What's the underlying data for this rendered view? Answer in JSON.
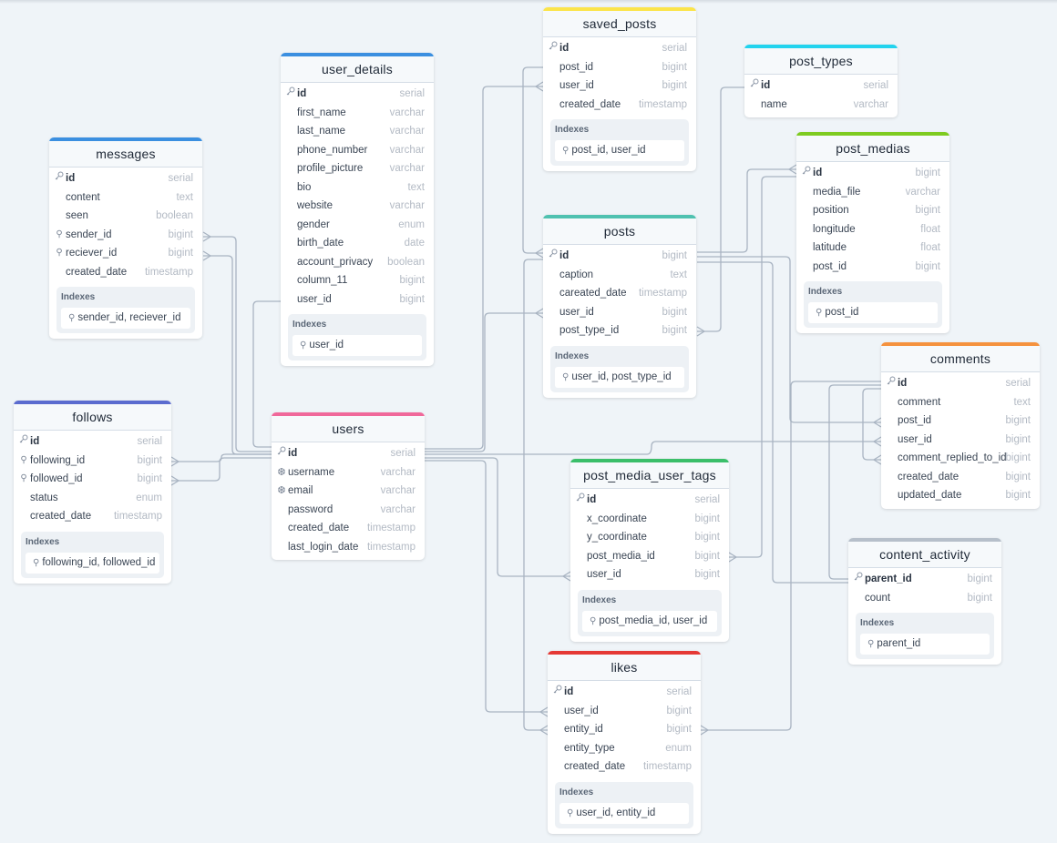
{
  "tables": [
    {
      "key": "saved_posts",
      "name": "saved_posts",
      "color": "#fbe44a",
      "columns": [
        {
          "name": "id",
          "type": "serial",
          "pk": true
        },
        {
          "name": "post_id",
          "type": "bigint"
        },
        {
          "name": "user_id",
          "type": "bigint"
        },
        {
          "name": "created_date",
          "type": "timestamp"
        }
      ],
      "indexes": [
        "post_id, user_id"
      ]
    },
    {
      "key": "post_types",
      "name": "post_types",
      "color": "#22d3ee",
      "columns": [
        {
          "name": "id",
          "type": "serial",
          "pk": true
        },
        {
          "name": "name",
          "type": "varchar"
        }
      ],
      "indexes": []
    },
    {
      "key": "user_details",
      "name": "user_details",
      "color": "#3b8fe0",
      "columns": [
        {
          "name": "id",
          "type": "serial",
          "pk": true
        },
        {
          "name": "first_name",
          "type": "varchar"
        },
        {
          "name": "last_name",
          "type": "varchar"
        },
        {
          "name": "phone_number",
          "type": "varchar"
        },
        {
          "name": "profile_picture",
          "type": "varchar"
        },
        {
          "name": "bio",
          "type": "text"
        },
        {
          "name": "website",
          "type": "varchar"
        },
        {
          "name": "gender",
          "type": "enum"
        },
        {
          "name": "birth_date",
          "type": "date"
        },
        {
          "name": "account_privacy",
          "type": "boolean"
        },
        {
          "name": "column_11",
          "type": "bigint"
        },
        {
          "name": "user_id",
          "type": "bigint"
        }
      ],
      "indexes": [
        "user_id"
      ]
    },
    {
      "key": "messages",
      "name": "messages",
      "color": "#3b8fe0",
      "columns": [
        {
          "name": "id",
          "type": "serial",
          "pk": true
        },
        {
          "name": "content",
          "type": "text"
        },
        {
          "name": "seen",
          "type": "boolean"
        },
        {
          "name": "sender_id",
          "type": "bigint",
          "index": true
        },
        {
          "name": "reciever_id",
          "type": "bigint",
          "index": true
        },
        {
          "name": "created_date",
          "type": "timestamp"
        }
      ],
      "indexes": [
        "sender_id, reciever_id"
      ]
    },
    {
      "key": "post_medias",
      "name": "post_medias",
      "color": "#7ecb20",
      "columns": [
        {
          "name": "id",
          "type": "bigint",
          "pk": true
        },
        {
          "name": "media_file",
          "type": "varchar"
        },
        {
          "name": "position",
          "type": "bigint"
        },
        {
          "name": "longitude",
          "type": "float"
        },
        {
          "name": "latitude",
          "type": "float"
        },
        {
          "name": "post_id",
          "type": "bigint"
        }
      ],
      "indexes": [
        "post_id"
      ]
    },
    {
      "key": "posts",
      "name": "posts",
      "color": "#4fc1b0",
      "columns": [
        {
          "name": "id",
          "type": "bigint",
          "pk": true
        },
        {
          "name": "caption",
          "type": "text"
        },
        {
          "name": "careated_date",
          "type": "timestamp"
        },
        {
          "name": "user_id",
          "type": "bigint"
        },
        {
          "name": "post_type_id",
          "type": "bigint"
        }
      ],
      "indexes": [
        "user_id, post_type_id"
      ]
    },
    {
      "key": "comments",
      "name": "comments",
      "color": "#f5923e",
      "columns": [
        {
          "name": "id",
          "type": "serial",
          "pk": true
        },
        {
          "name": "comment",
          "type": "text"
        },
        {
          "name": "post_id",
          "type": "bigint"
        },
        {
          "name": "user_id",
          "type": "bigint"
        },
        {
          "name": "comment_replied_to_id",
          "type": "bigint"
        },
        {
          "name": "created_date",
          "type": "bigint"
        },
        {
          "name": "updated_date",
          "type": "bigint"
        }
      ],
      "indexes": []
    },
    {
      "key": "follows",
      "name": "follows",
      "color": "#5b6ccf",
      "columns": [
        {
          "name": "id",
          "type": "serial",
          "pk": true
        },
        {
          "name": "following_id",
          "type": "bigint",
          "index": true
        },
        {
          "name": "followed_id",
          "type": "bigint",
          "index": true
        },
        {
          "name": "status",
          "type": "enum"
        },
        {
          "name": "created_date",
          "type": "timestamp"
        }
      ],
      "indexes": [
        "following_id, followed_id"
      ]
    },
    {
      "key": "users",
      "name": "users",
      "color": "#f0689a",
      "columns": [
        {
          "name": "id",
          "type": "serial",
          "pk": true
        },
        {
          "name": "username",
          "type": "varchar",
          "unique": true
        },
        {
          "name": "email",
          "type": "varchar",
          "unique": true
        },
        {
          "name": "password",
          "type": "varchar"
        },
        {
          "name": "created_date",
          "type": "timestamp"
        },
        {
          "name": "last_login_date",
          "type": "timestamp"
        }
      ],
      "indexes": []
    },
    {
      "key": "post_media_user_tags",
      "name": "post_media_user_tags",
      "color": "#3cbf6a",
      "columns": [
        {
          "name": "id",
          "type": "serial",
          "pk": true
        },
        {
          "name": "x_coordinate",
          "type": "bigint"
        },
        {
          "name": "y_coordinate",
          "type": "bigint"
        },
        {
          "name": "post_media_id",
          "type": "bigint"
        },
        {
          "name": "user_id",
          "type": "bigint"
        }
      ],
      "indexes": [
        "post_media_id, user_id"
      ]
    },
    {
      "key": "content_activity",
      "name": "content_activity",
      "color": "#b6bfca",
      "columns": [
        {
          "name": "parent_id",
          "type": "bigint",
          "pk": true
        },
        {
          "name": "count",
          "type": "bigint"
        }
      ],
      "indexes": [
        "parent_id"
      ]
    },
    {
      "key": "likes",
      "name": "likes",
      "color": "#e53935",
      "columns": [
        {
          "name": "id",
          "type": "serial",
          "pk": true
        },
        {
          "name": "user_id",
          "type": "bigint"
        },
        {
          "name": "entity_id",
          "type": "bigint"
        },
        {
          "name": "entity_type",
          "type": "enum"
        },
        {
          "name": "created_date",
          "type": "timestamp"
        }
      ],
      "indexes": [
        "user_id, entity_id"
      ]
    }
  ],
  "labels": {
    "indexes": "Indexes"
  },
  "icons": {
    "primary_key": "key-icon",
    "index": "index-icon",
    "unique": "unique-icon"
  },
  "relationships": [
    {
      "from": "messages.sender_id",
      "to": "users.id",
      "cardinality": "many-to-one"
    },
    {
      "from": "messages.reciever_id",
      "to": "users.id",
      "cardinality": "many-to-one"
    },
    {
      "from": "follows.following_id",
      "to": "users.id",
      "cardinality": "many-to-one"
    },
    {
      "from": "follows.followed_id",
      "to": "users.id",
      "cardinality": "many-to-one"
    },
    {
      "from": "user_details.user_id",
      "to": "users.id",
      "cardinality": "one-to-one"
    },
    {
      "from": "saved_posts.user_id",
      "to": "users.id",
      "cardinality": "many-to-one"
    },
    {
      "from": "saved_posts.post_id",
      "to": "posts.id",
      "cardinality": "many-to-one"
    },
    {
      "from": "posts.user_id",
      "to": "users.id",
      "cardinality": "many-to-one"
    },
    {
      "from": "posts.post_type_id",
      "to": "post_types.id",
      "cardinality": "many-to-one"
    },
    {
      "from": "post_medias.id",
      "to": "posts.id",
      "cardinality": "many-to-one"
    },
    {
      "from": "post_media_user_tags.post_media_id",
      "to": "post_medias.id",
      "cardinality": "many-to-one"
    },
    {
      "from": "post_media_user_tags.user_id",
      "to": "users.id",
      "cardinality": "many-to-one"
    },
    {
      "from": "likes.user_id",
      "to": "users.id",
      "cardinality": "many-to-one"
    },
    {
      "from": "likes.entity_id",
      "to": "posts.id",
      "cardinality": "many-to-one"
    },
    {
      "from": "comments.post_id",
      "to": "posts.id",
      "cardinality": "many-to-one"
    },
    {
      "from": "comments.user_id",
      "to": "users.id",
      "cardinality": "many-to-one"
    },
    {
      "from": "comments.comment_replied_to_id",
      "to": "comments.id",
      "cardinality": "many-to-one"
    },
    {
      "from": "content_activity.parent_id",
      "to": "comments.id",
      "cardinality": "one-to-one"
    },
    {
      "from": "content_activity.parent_id",
      "to": "posts.id",
      "cardinality": "one-to-one"
    }
  ]
}
